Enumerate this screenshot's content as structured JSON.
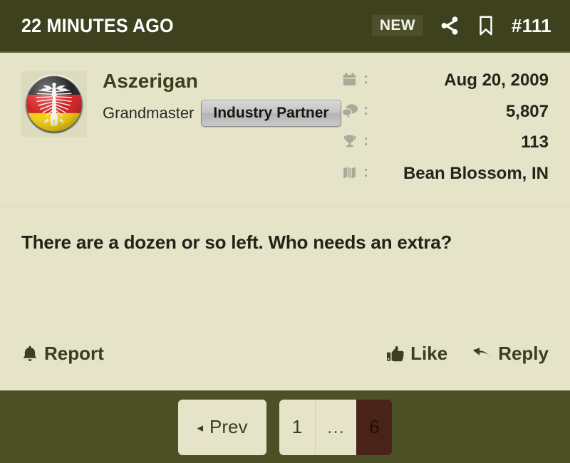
{
  "header": {
    "timestamp": "22 MINUTES AGO",
    "new_badge": "NEW",
    "share_icon": "share-icon",
    "bookmark_icon": "bookmark-icon",
    "post_number": "#111",
    "background_color": "#3d411e",
    "text_color": "#ffffff"
  },
  "post": {
    "author": {
      "avatar_icon": "german-flag-eagle-avatar",
      "username": "Aszerigan",
      "rank": "Grandmaster",
      "badge": "Industry Partner"
    },
    "stats": [
      {
        "icon": "calendar-icon",
        "separator": ":",
        "value": "Aug 20, 2009"
      },
      {
        "icon": "comments-icon",
        "separator": ":",
        "value": "5,807"
      },
      {
        "icon": "trophy-icon",
        "separator": ":",
        "value": "113"
      },
      {
        "icon": "map-icon",
        "separator": ":",
        "value": "Bean Blossom, IN"
      }
    ],
    "body_text": "There are a dozen or so left. Who needs an extra?",
    "actions": {
      "report": {
        "label": "Report",
        "icon": "bell-icon"
      },
      "like": {
        "label": "Like",
        "icon": "thumbs-up-icon"
      },
      "reply": {
        "label": "Reply",
        "icon": "reply-arrow-icon"
      }
    },
    "background_color": "#e5e4c8",
    "text_color": "#23231a"
  },
  "pagination": {
    "prev": {
      "label": "Prev",
      "caret": "◂"
    },
    "pages": [
      {
        "label": "1",
        "active": false
      },
      {
        "label": "...",
        "active": false
      },
      {
        "label": "6",
        "active": true
      }
    ],
    "active_background": "#4a2318",
    "button_background": "#e5e4c8",
    "bar_background": "#4c5125"
  }
}
